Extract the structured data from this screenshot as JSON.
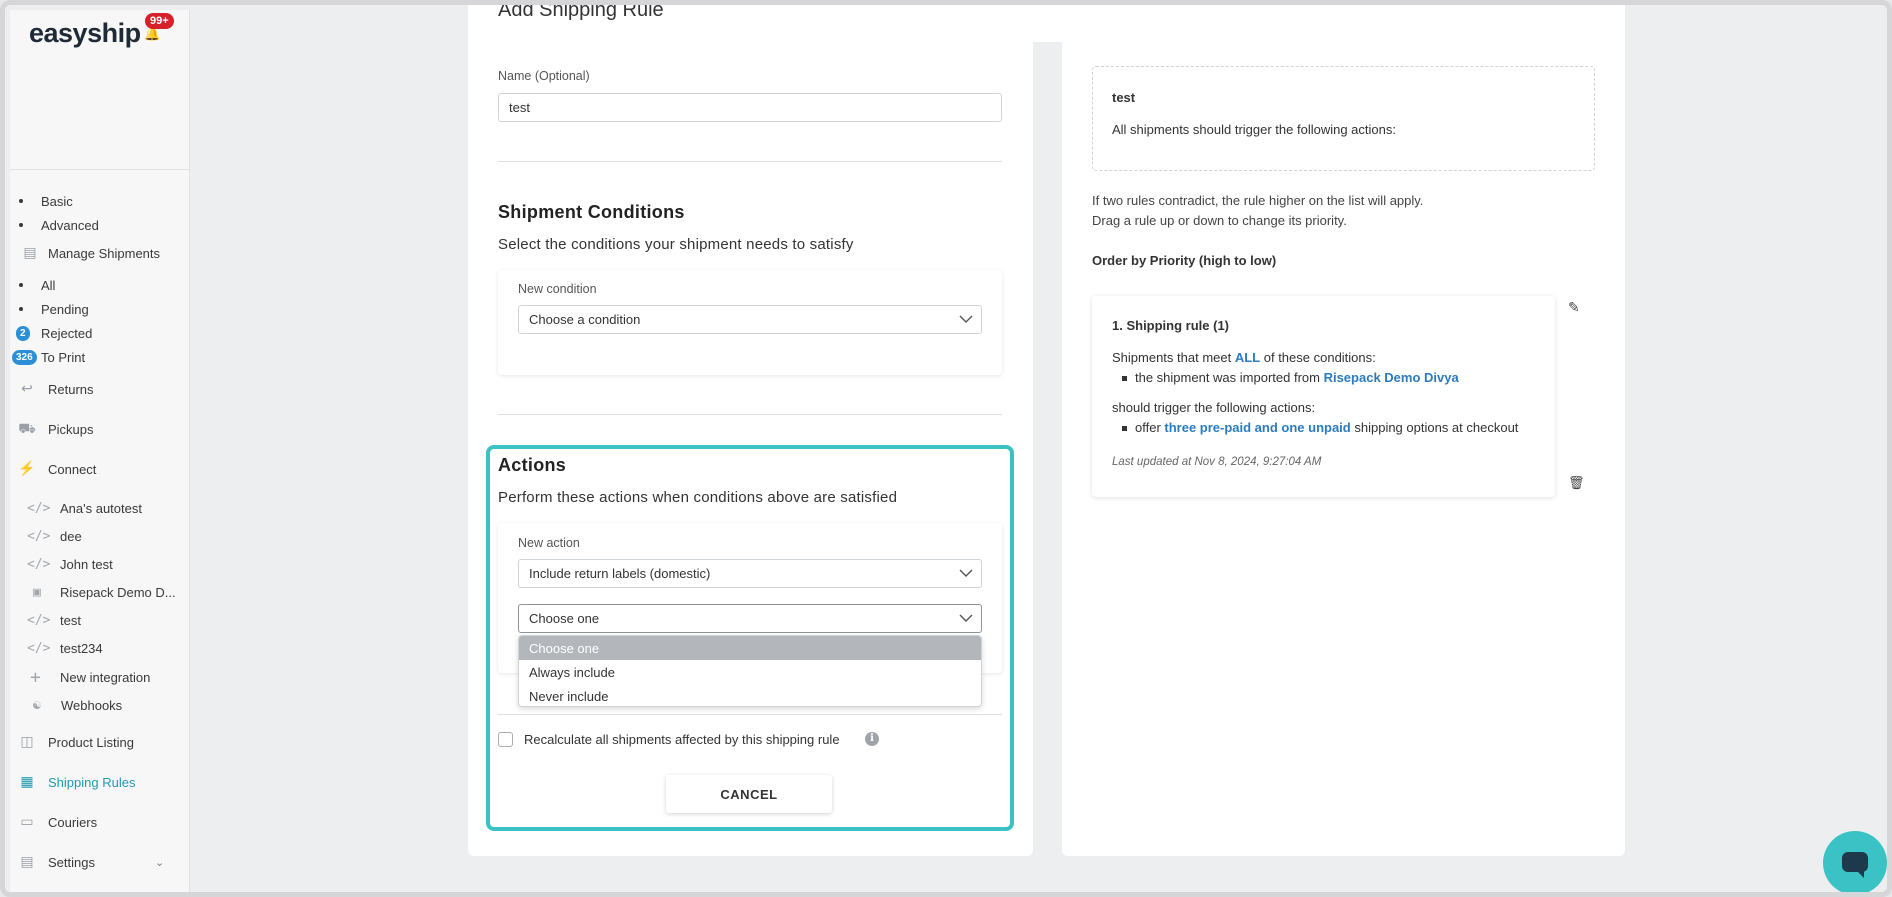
{
  "brand": {
    "logo_text": "easyship",
    "notifications": "99+",
    "accent": "#3bc2c4",
    "link_color": "#2c7bbf",
    "badge_color": "#d6212b"
  },
  "sidebar": {
    "sub_items_top": [
      {
        "label": "Basic"
      },
      {
        "label": "Advanced"
      }
    ],
    "manage_shipments": "Manage Shipments",
    "shipment_items": [
      {
        "label": "All",
        "badge": ""
      },
      {
        "label": "Pending",
        "badge": ""
      },
      {
        "label": "Rejected",
        "badge": "2"
      },
      {
        "label": "To Print",
        "badge": "326"
      }
    ],
    "returns": "Returns",
    "pickups": "Pickups",
    "connect": "Connect",
    "integrations": [
      {
        "label": "Ana's autotest",
        "icon": "code-icon"
      },
      {
        "label": "dee",
        "icon": "code-icon"
      },
      {
        "label": "John test",
        "icon": "code-icon"
      },
      {
        "label": "Risepack Demo D...",
        "icon": "store-icon"
      },
      {
        "label": "test",
        "icon": "code-icon"
      },
      {
        "label": "test234",
        "icon": "code-icon"
      },
      {
        "label": "New integration",
        "icon": "plus-icon"
      },
      {
        "label": "Webhooks",
        "icon": "webhook-icon"
      }
    ],
    "product_listing": "Product Listing",
    "shipping_rules": "Shipping Rules",
    "couriers": "Couriers",
    "settings": "Settings"
  },
  "form": {
    "title": "Add Shipping Rule",
    "name_label": "Name (Optional)",
    "name_value": "test",
    "conditions_title": "Shipment Conditions",
    "conditions_sub": "Select the conditions your shipment needs to satisfy",
    "new_condition_label": "New condition",
    "condition_placeholder": "Choose a condition",
    "actions_title": "Actions",
    "actions_sub": "Perform these actions when conditions above are satisfied",
    "new_action_label": "New action",
    "action_value": "Include return labels (domestic)",
    "choose_one_value": "Choose one",
    "dropdown_options": [
      "Choose one",
      "Always include",
      "Never include"
    ],
    "recalc_label": "Recalculate all shipments affected by this shipping rule",
    "cancel_label": "CANCEL"
  },
  "preview": {
    "name": "test",
    "text": "All shipments should trigger the following actions:",
    "note_line1": "If two rules contradict, the rule higher on the list will apply.",
    "note_line2": "Drag a rule up or down to change its priority.",
    "order_title": "Order by Priority (high to low)",
    "rule": {
      "title": "1. Shipping rule (1)",
      "meet_prefix": "Shipments that meet ",
      "meet_link": "ALL",
      "meet_suffix": " of these conditions:",
      "condition_prefix": "the shipment was imported from ",
      "condition_link": "Risepack Demo Divya",
      "trigger_text": "should trigger the following actions:",
      "action_prefix": "offer ",
      "action_link": "three pre-paid and one unpaid",
      "action_suffix": " shipping options at checkout",
      "updated": "Last updated at Nov 8, 2024, 9:27:04 AM"
    }
  }
}
